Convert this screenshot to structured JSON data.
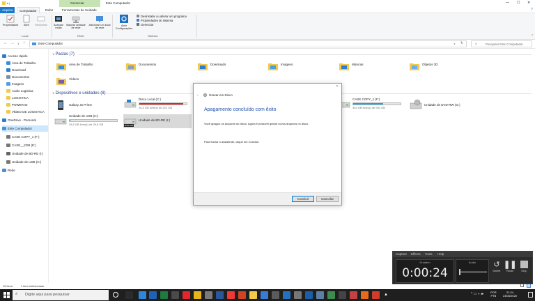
{
  "window": {
    "title": "Este Computador",
    "contextual_group": "Gerenciar",
    "controls": [
      "—",
      "☐",
      "✕"
    ]
  },
  "ribbon": {
    "tabs": [
      "Arquivo",
      "Computador",
      "Exibir",
      "Ferramentas de Unidade"
    ],
    "groups": [
      "Local",
      "Rede",
      "Sistema"
    ],
    "buttons": {
      "propriedades": "Propriedades",
      "abrir": "Abrir",
      "renomear": "Renomear",
      "acessar_midia": "Acessar mídia",
      "mapear": "Mapear unidade de rede",
      "adicionar_local": "Adicionar um local de rede",
      "abrir_config": "Abrir Configurações",
      "desinstalar": "Desinstalar ou alterar um programa",
      "prop_sistema": "Propriedades do sistema",
      "gerenciar": "Gerenciar"
    }
  },
  "address": {
    "path": "Este Computador",
    "search_placeholder": "Pesquisar Este Computador"
  },
  "nav": {
    "items": [
      {
        "label": "Acesso rápido",
        "icon": "star-icon",
        "color": "#2b7cd3"
      },
      {
        "label": "Área de Trabalho",
        "icon": "desktop-icon",
        "color": "#3b8ede"
      },
      {
        "label": "Download",
        "icon": "download-icon",
        "color": "#2b7cd3"
      },
      {
        "label": "Documentos",
        "icon": "documents-icon",
        "color": "#7a8ea6"
      },
      {
        "label": "Imagens",
        "icon": "images-icon",
        "color": "#4aa1e0"
      },
      {
        "label": "Audio Logistica",
        "icon": "folder-icon",
        "color": "#f2c94c"
      },
      {
        "label": "LOGISTICA",
        "icon": "folder-icon",
        "color": "#f2c94c"
      },
      {
        "label": "POWER BI",
        "icon": "folder-icon",
        "color": "#f2c94c"
      },
      {
        "label": "VÍDEO DE LOGISTICA",
        "icon": "folder-icon",
        "color": "#f2c94c"
      },
      {
        "label": "OneDrive - Personal",
        "icon": "cloud-icon",
        "color": "#2b7cd3"
      },
      {
        "label": "Este Computador",
        "icon": "computer-icon",
        "color": "#4a90d9"
      },
      {
        "label": "CASE COPY_1 (F:)",
        "icon": "drive-icon",
        "color": "#777"
      },
      {
        "label": "CASE__2GB (E:)",
        "icon": "drive-icon",
        "color": "#777"
      },
      {
        "label": "Unidade de BD-RE (I:)",
        "icon": "disc-icon",
        "color": "#666"
      },
      {
        "label": "Unidade de USB (H:)",
        "icon": "usb-icon",
        "color": "#777"
      },
      {
        "label": "Rede",
        "icon": "network-icon",
        "color": "#4a90d9"
      }
    ]
  },
  "content": {
    "folders_header": "Pastas (7)",
    "folders": [
      {
        "label": "Área de Trabalho",
        "icon": "desktop-folder-icon"
      },
      {
        "label": "Documentos",
        "icon": "documents-folder-icon"
      },
      {
        "label": "Downloads",
        "icon": "downloads-folder-icon"
      },
      {
        "label": "Imagens",
        "icon": "images-folder-icon"
      },
      {
        "label": "Músicas",
        "icon": "music-folder-icon"
      },
      {
        "label": "Objetos 3D",
        "icon": "objects3d-folder-icon"
      },
      {
        "label": "Vídeos",
        "icon": "videos-folder-icon"
      }
    ],
    "devices_header": "Dispositivos e unidades (8)",
    "devices": [
      {
        "label": "Galaxy J5 Prime",
        "sub": "",
        "fill": null,
        "fillcolor": ""
      },
      {
        "label": "Disco Local (C:)",
        "sub": "16,3 GB livre(s) de 222 GB",
        "fill": 0.93,
        "fillcolor": "#da2626"
      },
      {
        "label": "CASE COPY_1 (F:)",
        "sub": "344 GB livre(s) de 931 GB",
        "fill": 0.63,
        "fillcolor": "#26a0da"
      },
      {
        "label": "Unidade de DVD-RW (G:)",
        "sub": "",
        "fill": null,
        "fillcolor": ""
      },
      {
        "label": "Unidade de USB (H:)",
        "sub": "28,5 GB livre(s) de 28,8 GB",
        "fill": 0.01,
        "fillcolor": "#26a0da"
      },
      {
        "label": "Unidade de BD-RE (I:)",
        "sub": "",
        "fill": null,
        "fillcolor": ""
      }
    ],
    "dvd_badge": "DVD-RW"
  },
  "status": {
    "items": "15 itens",
    "selected": "1 item selecionado"
  },
  "dialog": {
    "caption": "Gravar em Disco",
    "heading": "Apagamento concluído com êxito",
    "body": "Você apagou os arquivos do disco. Agora é possível gravar novos arquivos no disco.",
    "instruction": "Para fechar o assistente, clique em Concluir.",
    "finish": "Concluir",
    "cancel": "Cancelar"
  },
  "capture": {
    "menu": [
      "Capture",
      "Effects",
      "Tools",
      "Help"
    ],
    "duration_label": "Duration",
    "audio_label": "Audio",
    "timer": "0:00:24",
    "delete": "Delete",
    "pause": "Pause",
    "stop": "Stop"
  },
  "taskbar": {
    "search_placeholder": "Digite aqui para pesquisar",
    "lang": "POR",
    "layout": "PTB",
    "time": "21:24",
    "date": "24/06/2020"
  }
}
